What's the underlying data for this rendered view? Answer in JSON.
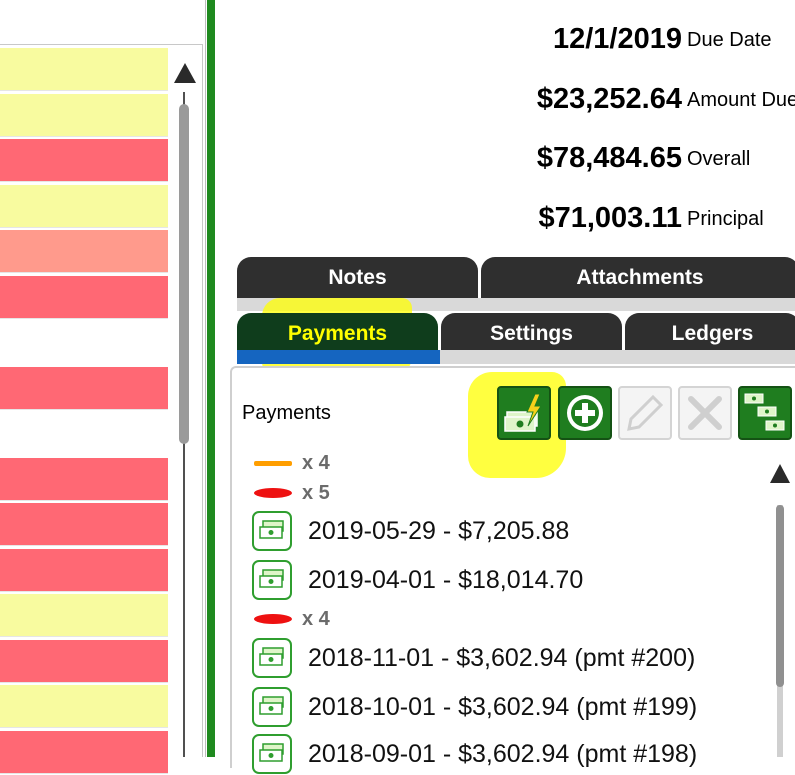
{
  "left_list": {
    "rows": [
      {
        "color": "#f8fb9f"
      },
      {
        "color": "#f8fb9f"
      },
      {
        "color": "#ff6874"
      },
      {
        "color": "#f8fb9f"
      },
      {
        "color": "#ff9a8c"
      },
      {
        "color": "#ff6874"
      },
      {
        "color": "#ffffff"
      },
      {
        "color": "#ff6874"
      },
      {
        "color": "#ffffff"
      },
      {
        "color": "#ff6874"
      },
      {
        "color": "#ff6874"
      },
      {
        "color": "#ff6874"
      },
      {
        "color": "#f8fb9f"
      },
      {
        "color": "#ff6874"
      },
      {
        "color": "#f8fb9f"
      },
      {
        "color": "#ff6874"
      }
    ]
  },
  "summary": [
    {
      "value": "12/1/2019",
      "label": "Due Date"
    },
    {
      "value": "$23,252.64",
      "label": "Amount Due"
    },
    {
      "value": "$78,484.65",
      "label": "Overall"
    },
    {
      "value": "$71,003.11",
      "label": "Principal"
    }
  ],
  "tabs_row1": [
    {
      "label": "Notes"
    },
    {
      "label": "Attachments"
    }
  ],
  "tabs_row2": [
    {
      "label": "Payments",
      "active": true
    },
    {
      "label": "Settings"
    },
    {
      "label": "Ledgers"
    }
  ],
  "payments": {
    "title": "Payments",
    "toolbar": [
      {
        "icon": "quick-pay-icon",
        "enabled": true
      },
      {
        "icon": "add-icon",
        "enabled": true
      },
      {
        "icon": "edit-icon",
        "enabled": false
      },
      {
        "icon": "delete-icon",
        "enabled": false
      },
      {
        "icon": "multiple-payments-icon",
        "enabled": true
      }
    ],
    "legend": [
      {
        "marker": "orange-line",
        "count": "x 4"
      },
      {
        "marker": "red-oval",
        "count": "x 5"
      }
    ],
    "items": [
      {
        "text": "2019-05-29 - $7,205.88"
      },
      {
        "text": "2019-04-01 - $18,014.70"
      }
    ],
    "legend2": {
      "marker": "red-oval",
      "count": "x 4"
    },
    "items2": [
      {
        "text": "2018-11-01 - $3,602.94 (pmt #200)"
      },
      {
        "text": "2018-10-01 - $3,602.94 (pmt #199)"
      },
      {
        "text": "2018-09-01 - $3,602.94 (pmt #198)"
      }
    ]
  },
  "colors": {
    "accent_green": "#1f8a1f",
    "tab_dark": "#2f2f2f",
    "active_tab_text": "#ffff00",
    "highlight": "#ffff00"
  }
}
